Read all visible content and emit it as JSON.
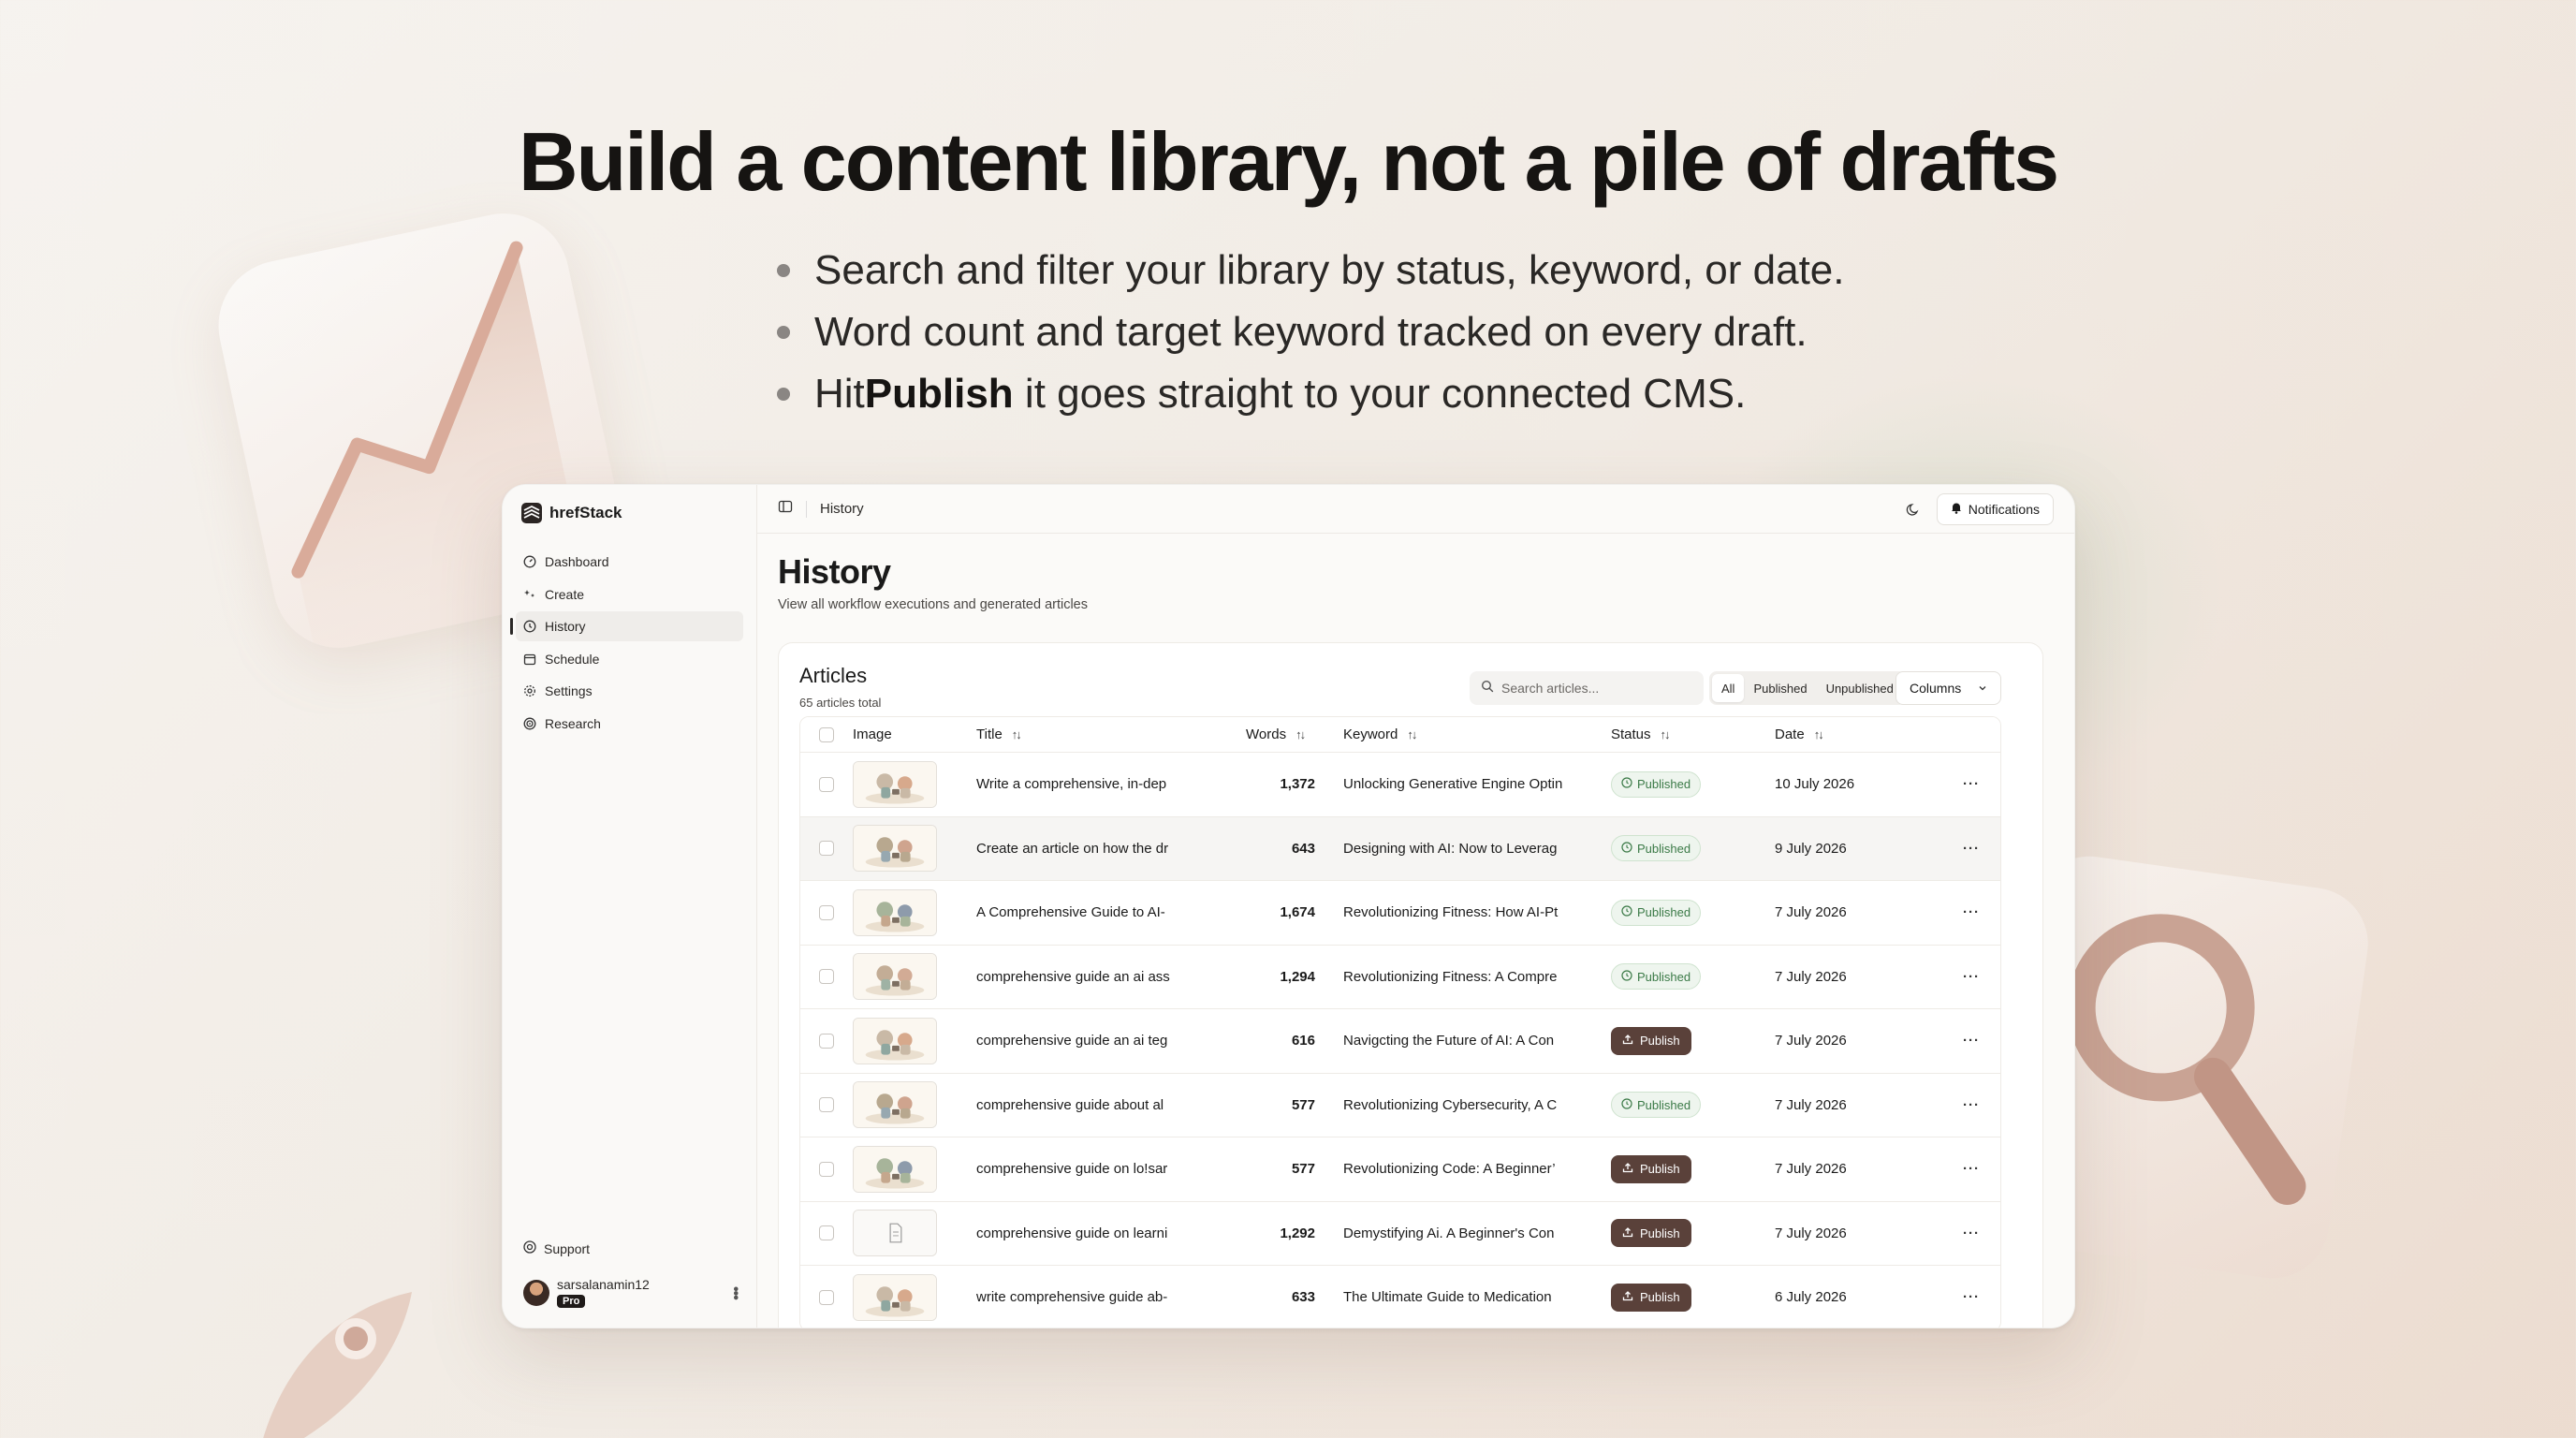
{
  "hero": {
    "headline": "Build a content library, not a pile of drafts",
    "bullets": [
      {
        "pre": "Search and filter your library by status, keyword, or date.",
        "bold": "",
        "post": ""
      },
      {
        "pre": "Word count and target keyword tracked on every draft.",
        "bold": "",
        "post": ""
      },
      {
        "pre": "Hit ",
        "bold": "Publish",
        "post": " it goes straight to your connected CMS."
      }
    ]
  },
  "app": {
    "brand": "hrefStack",
    "nav": [
      {
        "label": "Dashboard",
        "icon": "dashboard-icon"
      },
      {
        "label": "Create",
        "icon": "sparkle-icon"
      },
      {
        "label": "History",
        "icon": "clock-icon",
        "active": true
      },
      {
        "label": "Schedule",
        "icon": "calendar-icon"
      },
      {
        "label": "Settings",
        "icon": "gear-icon"
      },
      {
        "label": "Research",
        "icon": "target-icon"
      }
    ],
    "support_label": "Support",
    "user": {
      "name": "sarsalanamin12",
      "plan": "Pro"
    },
    "breadcrumb": "History",
    "notifications_label": "Notifications",
    "page_title": "History",
    "page_subtitle": "View all workflow executions and generated articles"
  },
  "articles": {
    "title": "Articles",
    "count": "65 articles total",
    "search_placeholder": "Search articles...",
    "filters": [
      "All",
      "Published",
      "Unpublished"
    ],
    "active_filter": "All",
    "columns_label": "Columns",
    "headers": {
      "image": "Image",
      "title": "Title",
      "words": "Words",
      "keyword": "Keyword",
      "status": "Status",
      "date": "Date"
    },
    "publish_label": "Publish",
    "published_label": "Published",
    "rows": [
      {
        "title": "Write a comprehensive, in-dep",
        "words": "1,372",
        "keyword": "Unlocking Generative Engine Optin",
        "status": "Published",
        "date": "10 July 2026",
        "thumb": "illustration"
      },
      {
        "title": "Create an article on how the dr",
        "words": "643",
        "keyword": "Designing with AI: Now to Leverag",
        "status": "Published",
        "date": "9 July 2026",
        "thumb": "illustration"
      },
      {
        "title": "A Comprehensive Guide to AI-",
        "words": "1,674",
        "keyword": "Revolutionizing Fitness: How AI-Pt",
        "status": "Published",
        "date": "7 July 2026",
        "thumb": "illustration"
      },
      {
        "title": "comprehensive guide an ai ass",
        "words": "1,294",
        "keyword": "Revolutionizing Fitness: A Compre",
        "status": "Published",
        "date": "7 July 2026",
        "thumb": "illustration"
      },
      {
        "title": "comprehensive guide an ai teg",
        "words": "616",
        "keyword": "Navigcting the Future of AI: A Con",
        "status": "Publish",
        "date": "7 July 2026",
        "thumb": "illustration"
      },
      {
        "title": "comprehensive guide about al",
        "words": "577",
        "keyword": "Revolutionizing Cybersecurity, A C",
        "status": "Published",
        "date": "7 July 2026",
        "thumb": "illustration"
      },
      {
        "title": "comprehensive guide on lo!sar",
        "words": "577",
        "keyword": "Revolutionizing Code: A Beginner’",
        "status": "Publish",
        "date": "7 July 2026",
        "thumb": "illustration"
      },
      {
        "title": "comprehensive guide on learni",
        "words": "1,292",
        "keyword": "Demystifying Ai. A Beginner's Con",
        "status": "Publish",
        "date": "7 July 2026",
        "thumb": "document"
      },
      {
        "title": "write comprehensive guide ab-",
        "words": "633",
        "keyword": "The Ultimate Guide to Medication",
        "status": "Publish",
        "date": "6 July 2026",
        "thumb": "illustration"
      }
    ]
  },
  "colors": {
    "accent_publish": "#5a413a",
    "published_green": "#3b7a47"
  }
}
